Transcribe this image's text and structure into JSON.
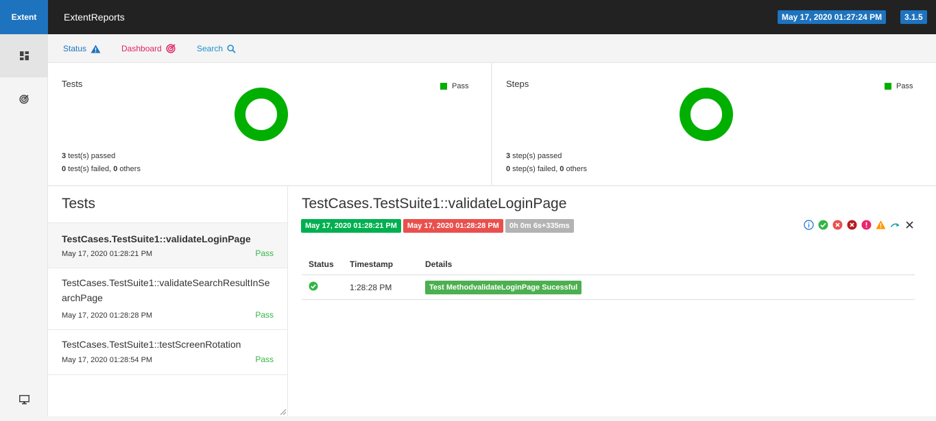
{
  "topbar": {
    "brand": "Extent",
    "title": "ExtentReports",
    "date": "May 17, 2020 01:27:24 PM",
    "version": "3.1.5"
  },
  "sidenav": {
    "items": [
      {
        "icon": "dashboard-grid-icon"
      },
      {
        "icon": "target-icon"
      },
      {
        "icon": "monitor-icon"
      }
    ]
  },
  "subnav": {
    "status": "Status",
    "dashboard": "Dashboard",
    "search": "Search"
  },
  "summary": {
    "tests": {
      "title": "Tests",
      "legend": "Pass",
      "stat_line1_count": "3",
      "stat_line1_text": " test(s) passed",
      "stat_line2_count": "0",
      "stat_line2_text": " test(s) failed, ",
      "stat_line2_others": "0",
      "stat_line2_suffix": " others",
      "pass_fraction": 1.0
    },
    "steps": {
      "title": "Steps",
      "legend": "Pass",
      "stat_line1_count": "3",
      "stat_line1_text": " step(s) passed",
      "stat_line2_count": "0",
      "stat_line2_text": " step(s) failed, ",
      "stat_line2_others": "0",
      "stat_line2_suffix": " others",
      "pass_fraction": 1.0
    },
    "colors": {
      "pass": "#00af00"
    }
  },
  "testlist": {
    "title": "Tests",
    "items": [
      {
        "name": "TestCases.TestSuite1::validateLoginPage",
        "time": "May 17, 2020 01:28:21 PM",
        "status": "Pass"
      },
      {
        "name": "TestCases.TestSuite1::validateSearchResultInSearchPage",
        "time": "May 17, 2020 01:28:28 PM",
        "status": "Pass"
      },
      {
        "name": "TestCases.TestSuite1::testScreenRotation",
        "time": "May 17, 2020 01:28:54 PM",
        "status": "Pass"
      }
    ]
  },
  "detail": {
    "title": "TestCases.TestSuite1::validateLoginPage",
    "start": "May 17, 2020 01:28:21 PM",
    "end": "May 17, 2020 01:28:28 PM",
    "duration": "0h 0m 6s+335ms",
    "columns": [
      "Status",
      "Timestamp",
      "Details"
    ],
    "rows": [
      {
        "status_icon": "check-circle-icon",
        "timestamp": "1:28:28 PM",
        "details": "Test MethodvalidateLoginPage Sucessful"
      }
    ]
  }
}
